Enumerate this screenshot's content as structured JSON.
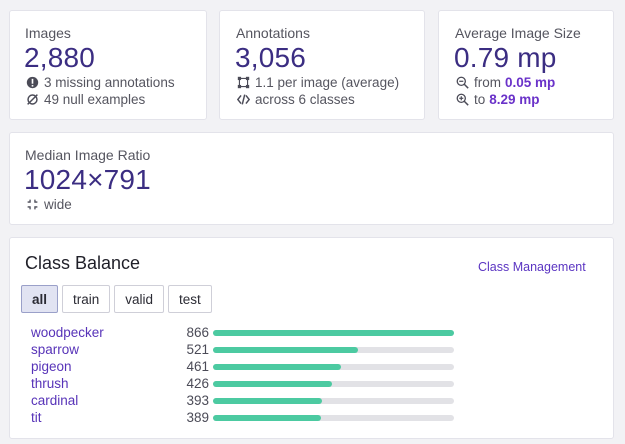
{
  "images": {
    "title": "Images",
    "value": "2,880",
    "missing": "3 missing annotations",
    "null_examples": "49 null examples"
  },
  "annotations": {
    "title": "Annotations",
    "value": "3,056",
    "per_image": "1.1 per image (average)",
    "classes": "across 6 classes"
  },
  "avg_size": {
    "title": "Average Image Size",
    "value": "0.79 mp",
    "from_label": "from",
    "from_value": "0.05 mp",
    "to_label": "to",
    "to_value": "8.29 mp"
  },
  "ratio": {
    "title": "Median Image Ratio",
    "value": "1024×791",
    "orientation": "wide"
  },
  "class_balance": {
    "title": "Class Balance",
    "management_link": "Class Management",
    "tabs": [
      {
        "label": "all",
        "active": true
      },
      {
        "label": "train",
        "active": false
      },
      {
        "label": "valid",
        "active": false
      },
      {
        "label": "test",
        "active": false
      }
    ],
    "max": 866,
    "classes": [
      {
        "name": "woodpecker",
        "count": 866
      },
      {
        "name": "sparrow",
        "count": 521
      },
      {
        "name": "pigeon",
        "count": 461
      },
      {
        "name": "thrush",
        "count": 426
      },
      {
        "name": "cardinal",
        "count": 393
      },
      {
        "name": "tit",
        "count": 389
      }
    ]
  },
  "colors": {
    "accent": "#3b2d82",
    "link": "#5733b8",
    "bar": "#4ccaa1",
    "bar_track": "#e2e2e6"
  }
}
